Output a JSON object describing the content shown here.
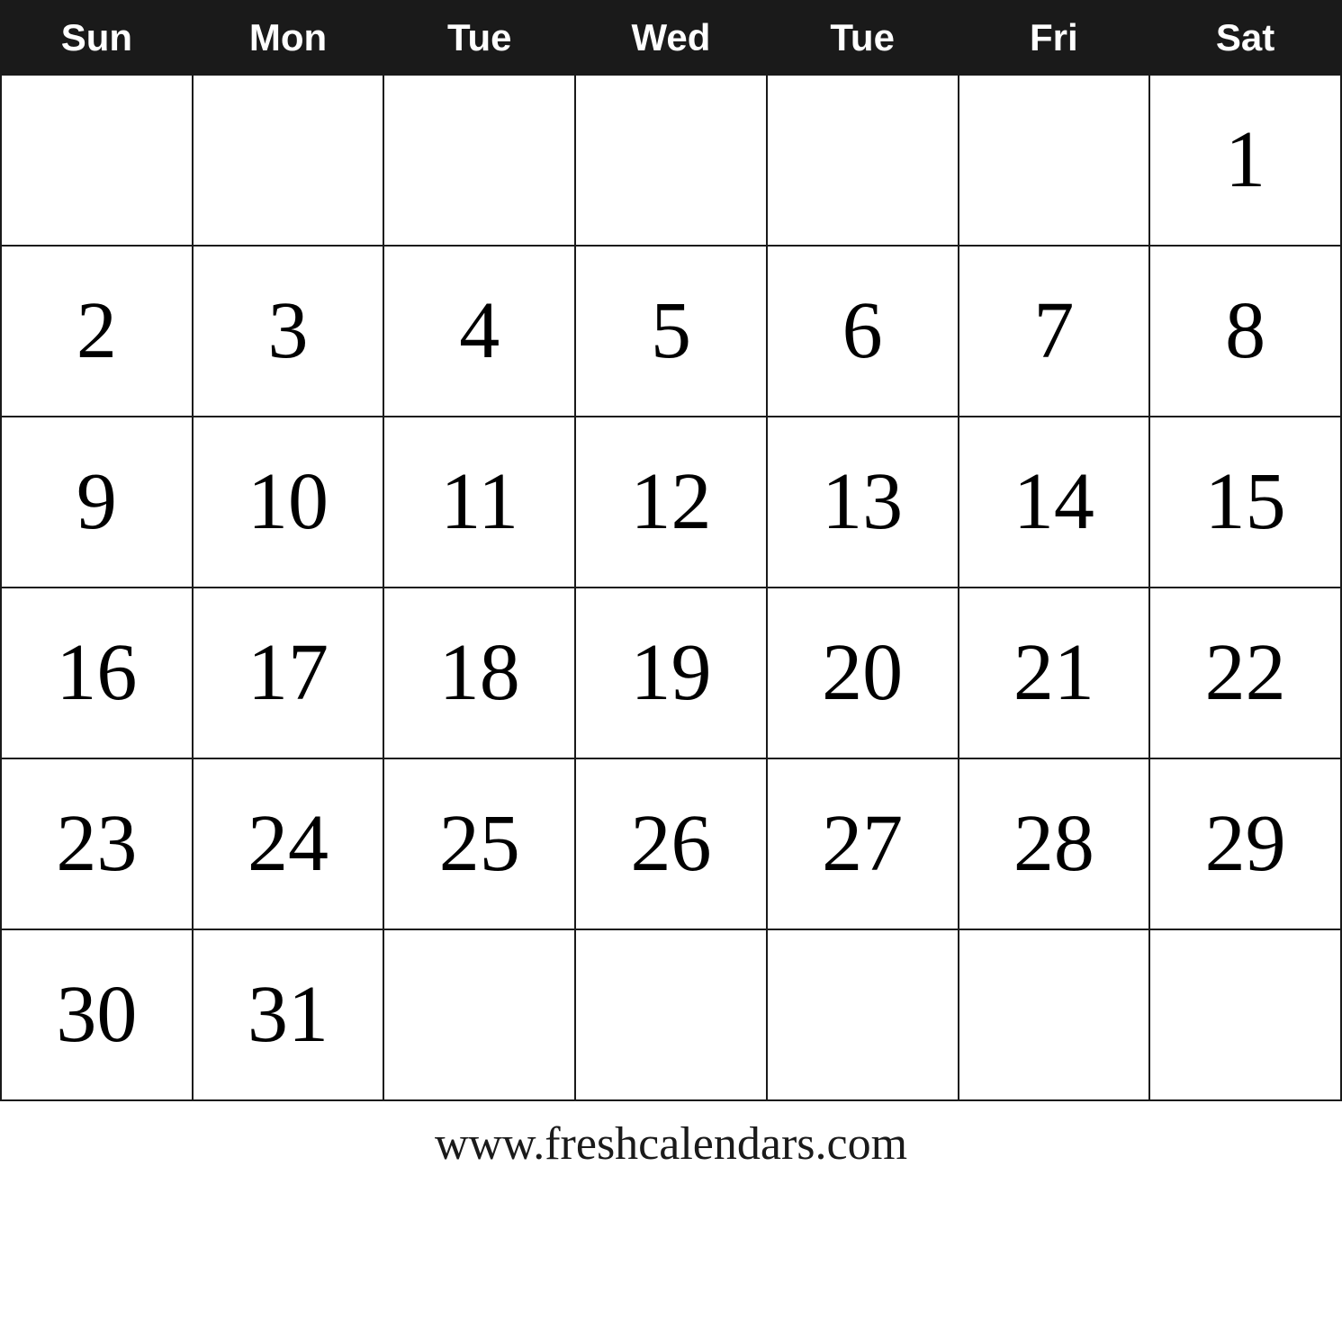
{
  "calendar": {
    "header": {
      "days": [
        "Sun",
        "Mon",
        "Tue",
        "Wed",
        "Tue",
        "Fri",
        "Sat"
      ]
    },
    "weeks": [
      [
        "",
        "",
        "",
        "",
        "",
        "",
        "1"
      ],
      [
        "2",
        "3",
        "4",
        "5",
        "6",
        "7",
        "8"
      ],
      [
        "9",
        "10",
        "11",
        "12",
        "13",
        "14",
        "15"
      ],
      [
        "16",
        "17",
        "18",
        "19",
        "20",
        "21",
        "22"
      ],
      [
        "23",
        "24",
        "25",
        "26",
        "27",
        "28",
        "29"
      ],
      [
        "30",
        "31",
        "",
        "",
        "",
        "",
        ""
      ]
    ],
    "footer": {
      "url": "www.freshcalendars.com"
    }
  }
}
